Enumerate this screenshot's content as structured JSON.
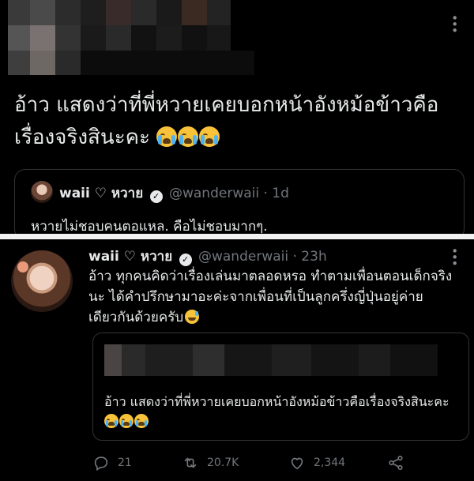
{
  "top_tweet": {
    "text": "อ้าว แสดงว่าที่พี่หวายเคยบอกหน้าอังหม้อข้าวคือเรื่องจริงสินะคะ",
    "quoted": {
      "name": "waii ♡ หวาย",
      "handle": "@wanderwaii",
      "time": "· 1d",
      "text": "หวายไม่ชอบคนตอแหล. คือไม่ชอบมากๆ."
    }
  },
  "bottom_tweet": {
    "name": "waii ♡ หวาย",
    "handle": "@wanderwaii",
    "time": "· 23h",
    "text": "อ้าว ทุกคนคิดว่าเรื่องเล่นมาตลอดหรอ ทำตามเพื่อนตอนเด็กจริงนะ ได้คำปรึกษามาอะค่ะจากเพื่อนที่เป็นลูกครึ่งญี่ปุ่นอยู่ค่ายเดียวกันด้วยครับ",
    "quoted_text": "อ้าว แสดงว่าที่พี่หวายเคยบอกหน้าอังหม้อข้าวคือเรื่องจริงสินะคะ",
    "replies": "21",
    "retweets": "20.7K",
    "likes": "2,344"
  },
  "icons": {
    "more": "more-vertical-icon",
    "verified": "verified-badge-icon",
    "reply": "reply-icon",
    "retweet": "retweet-icon",
    "like": "heart-icon",
    "share": "share-icon",
    "emoji_cry": "loudly-crying-face-emoji",
    "emoji_sweat": "grinning-sweat-emoji"
  },
  "colors": {
    "background": "#000000",
    "text": "#e7e9ea",
    "muted": "#71767b",
    "border": "#2f3336",
    "divider": "#f2f2f2"
  }
}
